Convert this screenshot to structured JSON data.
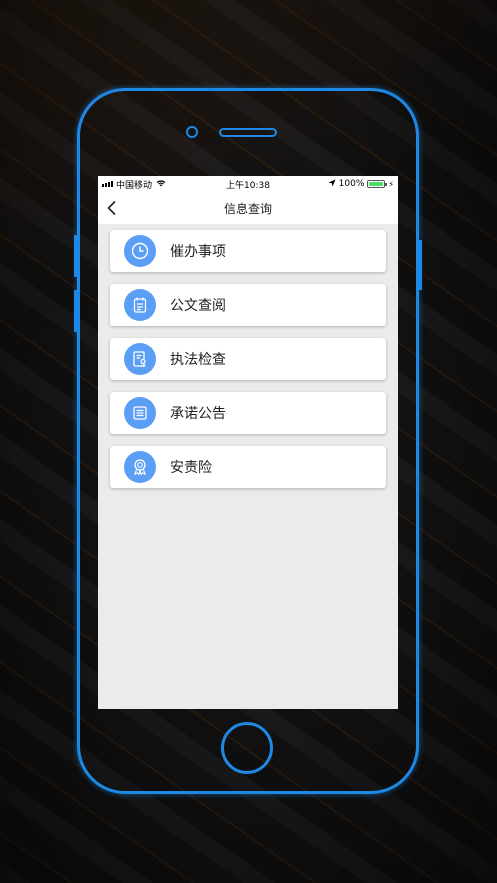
{
  "status_bar": {
    "carrier": "中国移动",
    "time": "上午10:38",
    "battery": "100%"
  },
  "nav": {
    "title": "信息查询"
  },
  "menu": {
    "items": [
      {
        "label": "催办事项",
        "icon": "clock-icon"
      },
      {
        "label": "公文查阅",
        "icon": "document-icon"
      },
      {
        "label": "执法检查",
        "icon": "inspection-icon"
      },
      {
        "label": "承诺公告",
        "icon": "notice-icon"
      },
      {
        "label": "安责险",
        "icon": "award-icon"
      }
    ]
  },
  "colors": {
    "accent": "#5b9ef5",
    "frame": "#1e88e5"
  }
}
